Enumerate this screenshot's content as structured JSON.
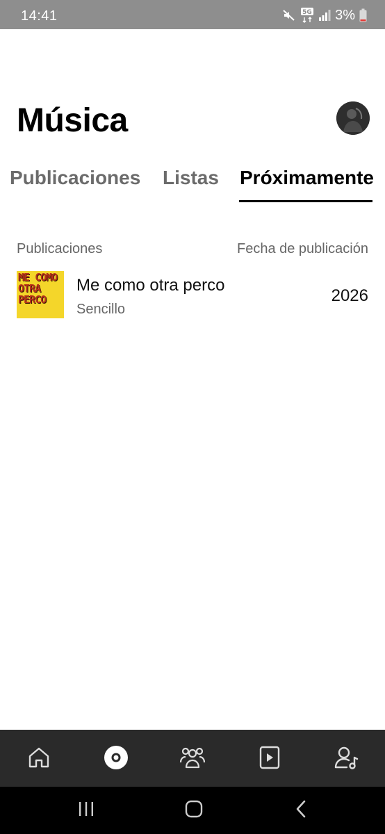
{
  "status_bar": {
    "time": "14:41",
    "network": "5G",
    "battery": "3%",
    "icons": [
      "mute-icon",
      "5g-icon",
      "signal-icon",
      "battery-low-icon"
    ]
  },
  "header": {
    "title": "Música",
    "avatar_icon": "profile-avatar"
  },
  "tabs": [
    {
      "label": "Publicaciones",
      "active": false
    },
    {
      "label": "Listas",
      "active": false
    },
    {
      "label": "Próximamente",
      "active": true
    }
  ],
  "list": {
    "column_left": "Publicaciones",
    "column_right": "Fecha de publicación",
    "items": [
      {
        "cover_text": "ME COMO OTRA PERCO",
        "title": "Me como otra perco",
        "type": "Sencillo",
        "date": "2026"
      }
    ]
  },
  "bottom_nav": {
    "items": [
      {
        "icon": "home-icon",
        "active": false
      },
      {
        "icon": "music-disc-icon",
        "active": true
      },
      {
        "icon": "audience-icon",
        "active": false
      },
      {
        "icon": "video-icon",
        "active": false
      },
      {
        "icon": "artist-profile-icon",
        "active": false
      }
    ]
  },
  "system_nav": {
    "icons": [
      "recents-icon",
      "home-button-icon",
      "back-icon"
    ]
  },
  "colors": {
    "status_bar": "#8e8e8e",
    "bottom_nav": "#2a2a2a",
    "cover_bg": "#f4d62a",
    "cover_text": "#b8321a",
    "active_tab": "#000000",
    "inactive_tab": "#6b6b6b"
  }
}
